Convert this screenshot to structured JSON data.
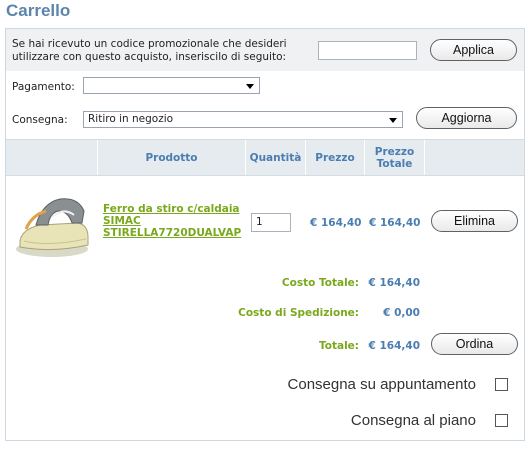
{
  "page": {
    "title": "Carrello"
  },
  "promo": {
    "text": "Se hai ricevuto un codice promozionale che desideri utilizzare con questo acquisto, inseriscilo di seguito:",
    "input_value": "",
    "apply_label": "Applica"
  },
  "payment": {
    "label": "Pagamento:",
    "selected": ""
  },
  "delivery": {
    "label": "Consegna:",
    "selected": "Ritiro in negozio",
    "update_label": "Aggiorna"
  },
  "table": {
    "headers": {
      "image": "",
      "product": "Prodotto",
      "quantity": "Quantità",
      "price": "Prezzo",
      "total_price": "Prezzo Totale"
    },
    "rows": [
      {
        "product_name": "Ferro da stiro c/caldaia SIMAC STIRELLA7720DUALVAP",
        "quantity": "1",
        "price": "€ 164,40",
        "total_price": "€ 164,40",
        "remove_label": "Elimina"
      }
    ]
  },
  "summary": {
    "total_cost_label": "Costo Totale:",
    "total_cost_value": "€ 164,40",
    "shipping_label": "Costo di Spedizione:",
    "shipping_value": "€ 0,00",
    "grand_total_label": "Totale:",
    "grand_total_value": "€ 164,40",
    "order_label": "Ordina"
  },
  "options": {
    "appointment_label": "Consegna su appuntamento",
    "appointment_checked": false,
    "floor_label": "Consegna al piano",
    "floor_checked": false
  },
  "colors": {
    "title": "#5b85ad",
    "header_text": "#4a7db0",
    "product_link": "#7aa81c",
    "header_bg": "#e6ebf0"
  }
}
